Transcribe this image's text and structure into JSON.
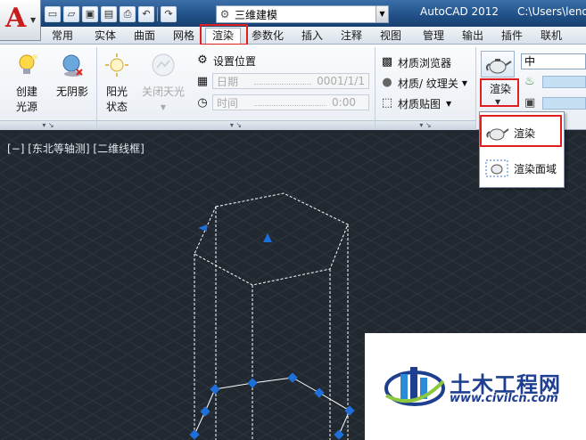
{
  "titlebar": {
    "app_name": "AutoCAD 2012",
    "file_path": "C:\\Users\\leno",
    "workspace": "三维建模",
    "app_logo": "A"
  },
  "qat_icons": [
    "new-icon",
    "open-icon",
    "save-icon",
    "saveas-icon",
    "print-icon",
    "undo-icon",
    "redo-icon"
  ],
  "tabs": [
    {
      "label": "常用"
    },
    {
      "label": "实体"
    },
    {
      "label": "曲面"
    },
    {
      "label": "网格"
    },
    {
      "label": "渲染"
    },
    {
      "label": "参数化"
    },
    {
      "label": "插入"
    },
    {
      "label": "注释"
    },
    {
      "label": "视图"
    },
    {
      "label": "管理"
    },
    {
      "label": "输出"
    },
    {
      "label": "插件"
    },
    {
      "label": "联机"
    }
  ],
  "ribbon": {
    "create_light": "创建\n光源",
    "create_light_l1": "创建",
    "create_light_l2": "光源",
    "no_shadow": "无阴影",
    "sun_status_l1": "阳光",
    "sun_status_l2": "状态",
    "turn_off_sky": "关闭天光",
    "set_location": "设置位置",
    "date_label": "日期",
    "date_value": "0001/1/1",
    "time_label": "时间",
    "time_value": "0:00",
    "mat_browser": "材质浏览器",
    "mat_texture": "材质/ 纹理关",
    "mat_mapping": "材质贴图",
    "render_quality": "中",
    "render_button": "渲染"
  },
  "dropdown": {
    "items": [
      {
        "label": "渲染"
      },
      {
        "label": "渲染面域"
      }
    ]
  },
  "viewport": {
    "label": "[−] [东北等轴测] [二维线框]"
  },
  "watermark": {
    "title": "土木工程网",
    "url": "www.civilcn.com"
  },
  "colors": {
    "accent_highlight": "#e02020",
    "viewport_bg": "#212830",
    "grip_blue": "#1e6fd9",
    "watermark_blue": "#1e3f8f"
  }
}
